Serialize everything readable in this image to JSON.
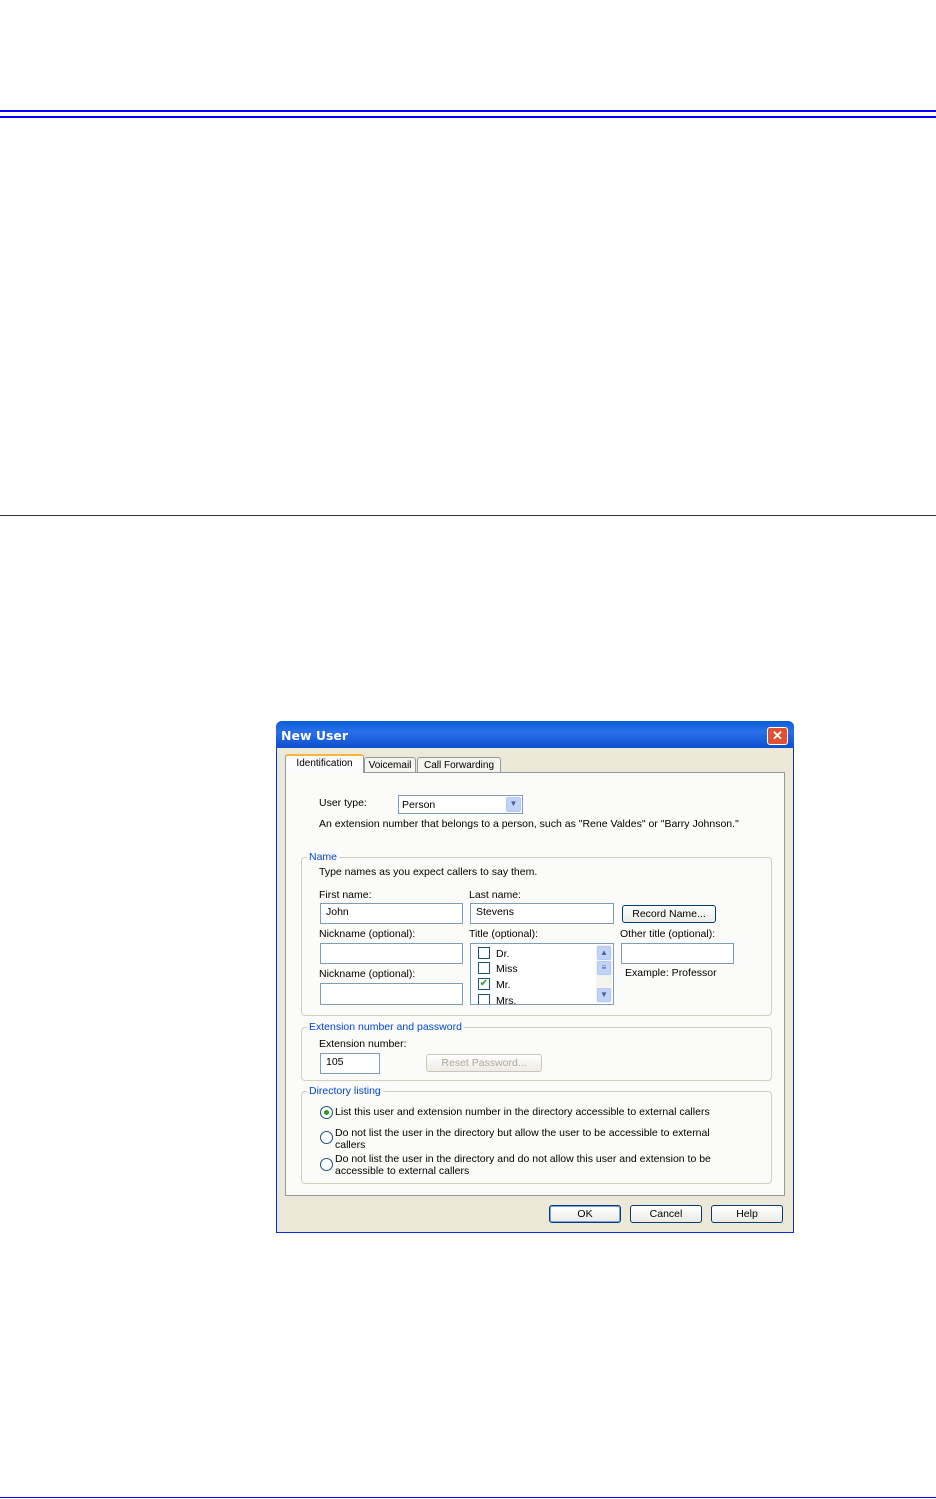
{
  "colors": {
    "rule": "#0000ff",
    "titlebar": "#0a5fd8",
    "legend": "#0046d5"
  },
  "dialog": {
    "title": "New User",
    "close_icon": "close-icon",
    "tabs": [
      {
        "label": "Identification",
        "active": true
      },
      {
        "label": "Voicemail",
        "active": false
      },
      {
        "label": "Call Forwarding",
        "active": false
      }
    ],
    "user_type": {
      "label": "User type:",
      "value": "Person",
      "description": "An extension number that belongs to a person, such as \"Rene Valdes\" or \"Barry Johnson.\""
    },
    "name_group": {
      "legend": "Name",
      "hint": "Type names as you expect callers to say them.",
      "first_name_label": "First name:",
      "first_name": "John",
      "last_name_label": "Last name:",
      "last_name": "Stevens",
      "record_name": "Record Name...",
      "nickname_label_1": "Nickname (optional):",
      "nickname_1": "",
      "nickname_label_2": "Nickname (optional):",
      "nickname_2": "",
      "title_label": "Title (optional):",
      "titles": [
        {
          "label": "Dr.",
          "checked": false
        },
        {
          "label": "Miss",
          "checked": false
        },
        {
          "label": "Mr.",
          "checked": true
        },
        {
          "label": "Mrs.",
          "checked": false
        }
      ],
      "other_title_label": "Other title (optional):",
      "other_title": "",
      "other_title_example": "Example: Professor"
    },
    "extension_group": {
      "legend": "Extension number and password",
      "label": "Extension number:",
      "value": "105",
      "reset_password": "Reset Password..."
    },
    "directory_group": {
      "legend": "Directory listing",
      "options": [
        {
          "label": "List this user and extension number in the directory accessible to external callers",
          "selected": true
        },
        {
          "label": "Do not list the user in the directory but allow the user to be accessible to external callers",
          "selected": false
        },
        {
          "label": "Do not list the user in the directory and do not allow this user and extension to be accessible to external callers",
          "selected": false
        }
      ]
    },
    "buttons": {
      "ok": "OK",
      "cancel": "Cancel",
      "help": "Help"
    }
  }
}
